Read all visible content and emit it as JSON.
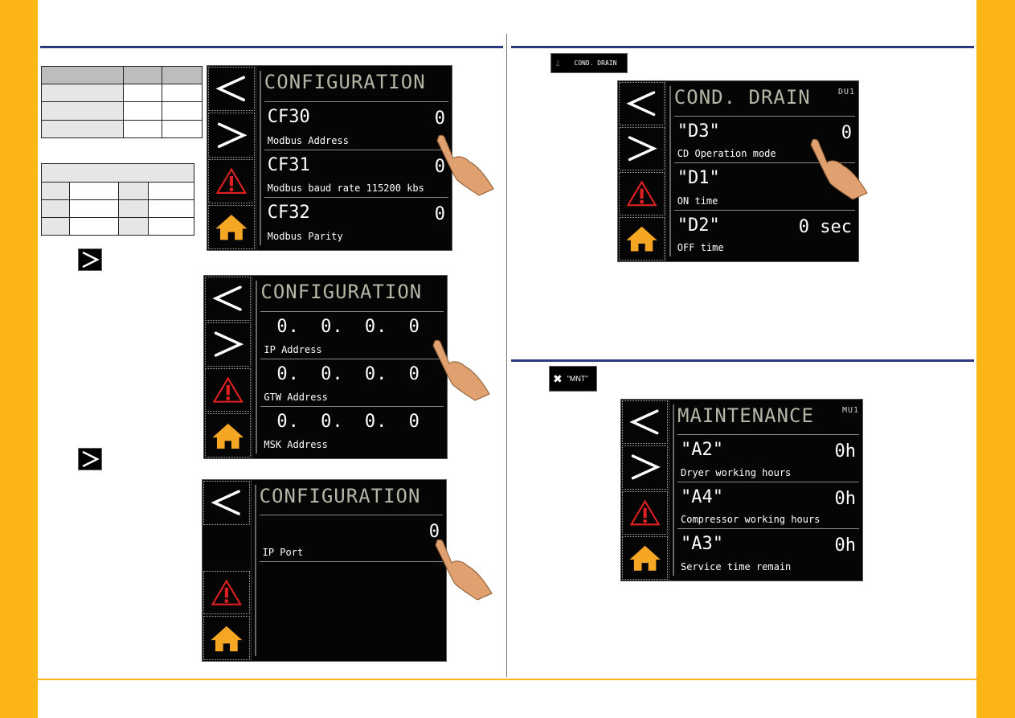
{
  "colors": {
    "accent_yellow": "#fbb616",
    "rule_blue": "#2a3a7c",
    "warning_red": "#e02020",
    "home_orange": "#f5a623"
  },
  "config_screen_1": {
    "title": "CONFIGURATION",
    "rows": [
      {
        "code": "CF30",
        "value": "0",
        "label": "Modbus Address"
      },
      {
        "code": "CF31",
        "value": "0",
        "label": "Modbus baud rate 115200 kbs"
      },
      {
        "code": "CF32",
        "value": "0",
        "label": "Modbus Parity"
      }
    ]
  },
  "config_screen_2": {
    "title": "CONFIGURATION",
    "rows": [
      {
        "code": "0. 0. 0. 0",
        "label": "IP Address"
      },
      {
        "code": "0. 0. 0. 0",
        "label": "GTW Address"
      },
      {
        "code": "0. 0. 0. 0",
        "label": "MSK Address"
      }
    ]
  },
  "config_screen_3": {
    "title": "CONFIGURATION",
    "rows": [
      {
        "value": "0",
        "label": "IP Port"
      }
    ]
  },
  "cond_drain_button": {
    "icon": "drop-icon",
    "label": "COND. DRAIN"
  },
  "cond_drain_screen": {
    "title": "COND. DRAIN",
    "badge": "DU1",
    "rows": [
      {
        "code": "\"D3\"",
        "value": "0",
        "label": "CD Operation mode"
      },
      {
        "code": "\"D1\"",
        "value": "0",
        "label": "ON time"
      },
      {
        "code": "\"D2\"",
        "value": "0 sec",
        "label": "OFF time"
      }
    ]
  },
  "mnt_button": {
    "icon": "wrench-screwdriver-icon",
    "label": "\"MNT\""
  },
  "maintenance_screen": {
    "title": "MAINTENANCE",
    "badge": "MU1",
    "rows": [
      {
        "code": "\"A2\"",
        "value": "0h",
        "label": "Dryer working hours"
      },
      {
        "code": "\"A4\"",
        "value": "0h",
        "label": "Compressor working hours"
      },
      {
        "code": "\"A3\"",
        "value": "0h",
        "label": "Service time remain"
      }
    ]
  }
}
